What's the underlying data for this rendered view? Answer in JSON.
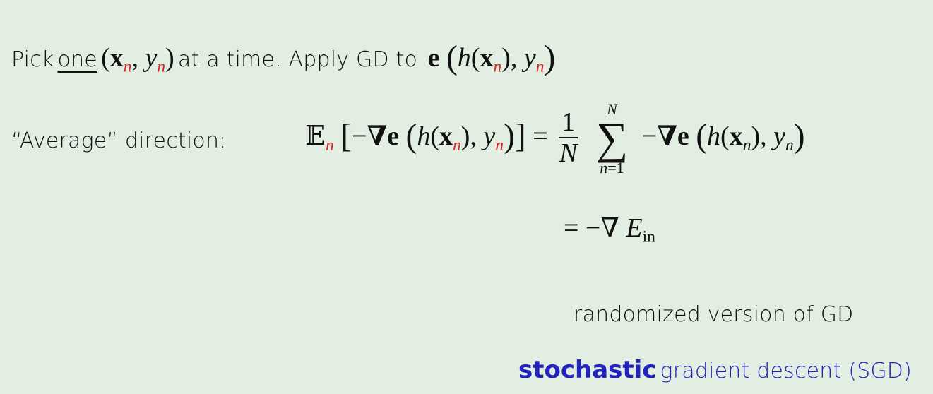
{
  "line1": {
    "prefix": "Pick",
    "one": "one",
    "mid": "at a time.  Apply GD to"
  },
  "line2": {
    "label": "“Average” direction:"
  },
  "notes": {
    "randomized": "randomized version of GD",
    "sgd_bold": "stochastic",
    "sgd_rest": "gradient descent (SGD)"
  },
  "colors": {
    "background": "#e1eee1",
    "highlight_red": "#e02020",
    "accent_blue": "#2222c0"
  }
}
